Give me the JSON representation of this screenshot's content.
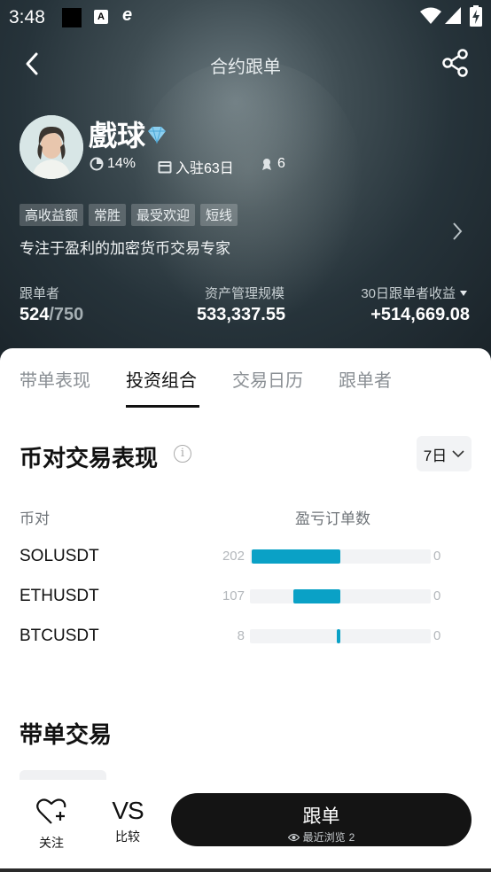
{
  "status_bar": {
    "time": "3:48",
    "icons": [
      "notification-square-icon",
      "app-a-icon",
      "browser-e-icon",
      "wifi-icon",
      "signal-icon",
      "battery-charging-icon"
    ],
    "app_a_label": "A",
    "browser_label": "e"
  },
  "header": {
    "title": "合约跟单",
    "back_icon": "back-arrow-icon",
    "share_icon": "share-icon"
  },
  "trader": {
    "name": "戲球",
    "badge_icon": "diamond-badge-icon",
    "win_rate": "14%",
    "days_joined": "入驻63日",
    "rank": "6",
    "tags": [
      "高收益额",
      "常胜",
      "最受欢迎",
      "短线"
    ],
    "bio": "专注于盈利的加密货币交易专家"
  },
  "stats": {
    "followers_label": "跟单者",
    "followers_value": "524",
    "followers_max": "/750",
    "aum_label": "资产管理规模",
    "aum_value": "533,337.55",
    "profit_label": "30日跟单者收益",
    "profit_value": "+514,669.08"
  },
  "tabs": [
    "带单表现",
    "投资组合",
    "交易日历",
    "跟单者"
  ],
  "active_tab": "投资组合",
  "pair_performance": {
    "title": "币对交易表现",
    "info_icon": "i",
    "period": "7日",
    "col_pair": "币对",
    "col_orders": "盈亏订单数",
    "win_color": "#0aa1c6",
    "rows": [
      {
        "pair": "SOLUSDT",
        "win": 202,
        "loss": 0,
        "win_label": "202",
        "loss_label": "0"
      },
      {
        "pair": "ETHUSDT",
        "win": 107,
        "loss": 0,
        "win_label": "107",
        "loss_label": "0"
      },
      {
        "pair": "BTCUSDT",
        "win": 8,
        "loss": 0,
        "win_label": "8",
        "loss_label": "0"
      }
    ]
  },
  "lead_trades": {
    "title": "带单交易"
  },
  "bottom_bar": {
    "favorite_label": "关注",
    "compare_icon_text": "VS",
    "compare_label": "比较",
    "follow_label": "跟单",
    "recent_views_label": "最近浏览",
    "recent_views_count": "2"
  }
}
